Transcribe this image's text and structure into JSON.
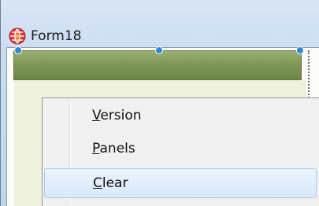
{
  "window": {
    "title": "Form18"
  },
  "menu": {
    "items": [
      {
        "label": "Version",
        "mnemonic": "V",
        "rest": "ersion",
        "highlighted": false
      },
      {
        "label": "Panels",
        "mnemonic": "P",
        "rest": "anels",
        "highlighted": false
      },
      {
        "label": "Clear",
        "mnemonic": "C",
        "rest": "lear",
        "highlighted": true
      }
    ]
  },
  "colors": {
    "panel_strip": "#7f9856",
    "selection_handle": "#2a8ad6",
    "menu_highlight": "#d9e9f8"
  },
  "icons": {
    "app": "delphi-app-icon"
  }
}
